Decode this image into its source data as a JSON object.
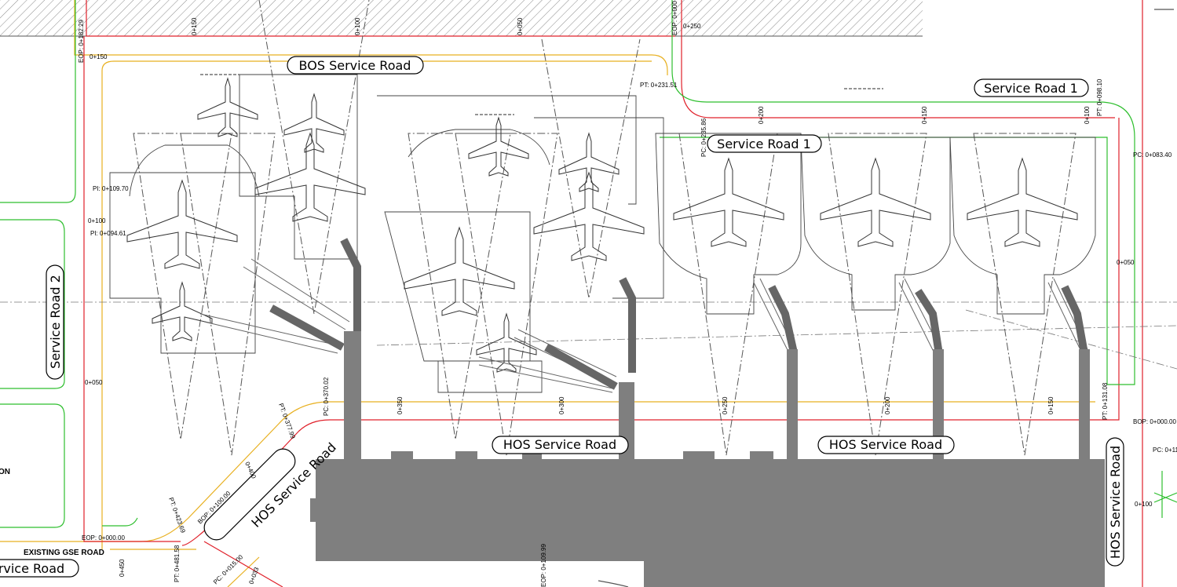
{
  "roads": {
    "bos_service_road": "BOS Service Road",
    "service_road_1_top": "Service Road 1",
    "service_road_1_mid": "Service Road 1",
    "service_road_2": "Service Road 2",
    "hos_center": "HOS Service Road",
    "hos_right": "HOS Service Road",
    "hos_diagonal": "HOS Service Road",
    "hos_vertical": "HOS Service Road",
    "service_road_bottom_left": "rvice Road",
    "existing_gse": "EXISTING GSE ROAD",
    "left_cut": "ON"
  },
  "stations": {
    "eop_182": "EOP: 0+182.29",
    "s150_left": "0+150",
    "s150_top": "0+150",
    "s100_top": "0+100",
    "s050_top": "0+050",
    "eop_000_top": "EOP: 0+000",
    "s250_top": "0+250",
    "pt_231": "PT: 0+231.51",
    "pt_098": "PT: 0+098.10",
    "s200_sr1": "0+200",
    "s150_sr1": "0+150",
    "s100_sr1": "0+100",
    "pc_235": "PC: 0+235.86",
    "pc_083": "PC: 0+083.40",
    "s050_right": "0+050",
    "pi_109": "PI: 0+109.70",
    "s100_left": "0+100",
    "pi_094": "PI: 0+094.61",
    "s050_left": "0+050",
    "eop_000_left": "EOP: 0+000.00",
    "pc_370": "PC: 0+370.02",
    "pi_377": "PT: 0+377.99",
    "s350": "0+350",
    "s300": "0+300",
    "s250": "0+250",
    "s200": "0+200",
    "s150": "0+150",
    "pt_131": "PT: 0+131.08",
    "bop_000": "BOP: 0+000.00",
    "pc_11x": "PC: 0+11",
    "s100_right": "0+100",
    "s400_diag": "0+400",
    "bop_100": "BOP: 0+100.00",
    "s423": "PT: 0+423.69",
    "s450": "0+450",
    "pt_481": "PT: 0+481.58",
    "pc_015": "PC: 0+015.00",
    "s_033": "0+033",
    "eop_109": "EOP: 0+109.99"
  },
  "colors": {
    "road_edge_red": "#e0202a",
    "road_edge_green": "#2fbf2f",
    "road_offset_orange": "#e8b020",
    "terminal_gray": "#7f7f7f",
    "linework": "#555555",
    "hatch": "#888888"
  }
}
